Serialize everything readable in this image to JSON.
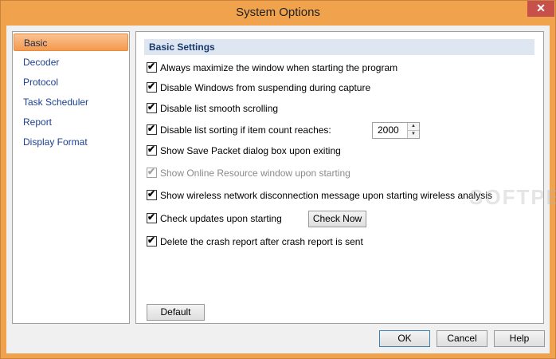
{
  "window": {
    "title": "System Options",
    "close_symbol": "✕"
  },
  "sidebar": {
    "items": [
      {
        "label": "Basic",
        "selected": true
      },
      {
        "label": "Decoder"
      },
      {
        "label": "Protocol"
      },
      {
        "label": "Task Scheduler"
      },
      {
        "label": "Report"
      },
      {
        "label": "Display Format"
      }
    ]
  },
  "panel": {
    "header": "Basic Settings",
    "options": [
      {
        "label": "Always maximize the window when starting the program",
        "checked": true
      },
      {
        "label": "Disable Windows from suspending during capture",
        "checked": true
      },
      {
        "label": "Disable list smooth scrolling",
        "checked": true
      },
      {
        "label": "Disable list sorting if item count reaches:",
        "checked": true
      },
      {
        "label": "Show Save Packet dialog box upon exiting",
        "checked": true
      },
      {
        "label": "Show Online Resource window upon starting",
        "checked": true,
        "disabled": true
      },
      {
        "label": "Show wireless network disconnection message upon starting wireless analysis",
        "checked": true
      },
      {
        "label": "Check updates upon starting",
        "checked": true
      },
      {
        "label": "Delete the crash report after crash report is sent",
        "checked": true
      }
    ],
    "sort_count_value": "2000",
    "check_now_label": "Check Now",
    "default_label": "Default",
    "watermark": "SOFTPEDIA"
  },
  "footer": {
    "ok_label": "OK",
    "cancel_label": "Cancel",
    "help_label": "Help"
  },
  "icons": {
    "check": "✔",
    "spin_up": "▲",
    "spin_down": "▼"
  }
}
